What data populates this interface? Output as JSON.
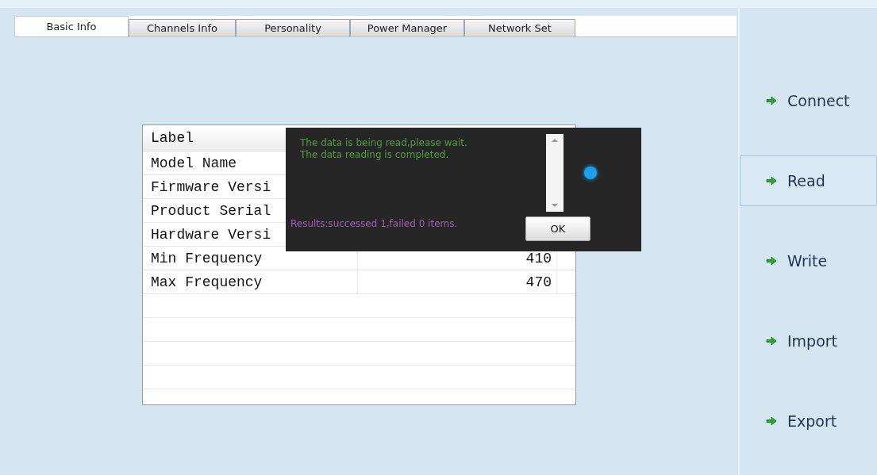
{
  "tabs": [
    {
      "label": "Basic Info",
      "selected": true
    },
    {
      "label": "Channels Info",
      "selected": false
    },
    {
      "label": "Personality",
      "selected": false
    },
    {
      "label": "Power Manager",
      "selected": false
    },
    {
      "label": "Network Set",
      "selected": false
    }
  ],
  "table": {
    "columns": [
      "Label"
    ],
    "rows": [
      {
        "label": "Model Name"
      },
      {
        "label": "Firmware Versi"
      },
      {
        "label": "Product Serial"
      },
      {
        "label": "Hardware Versi"
      },
      {
        "label": "Min Frequency",
        "value": "410"
      },
      {
        "label": "Max Frequency",
        "value": "470"
      }
    ]
  },
  "dialog": {
    "messages": [
      "The data is being read,please wait.",
      "The data reading is completed."
    ],
    "result": "Results:successed 1,failed 0 items.",
    "button": "OK"
  },
  "sidebar": {
    "buttons": [
      {
        "label": "Connect",
        "selected": false
      },
      {
        "label": "Read",
        "selected": true
      },
      {
        "label": "Write",
        "selected": false
      },
      {
        "label": "Import",
        "selected": false
      },
      {
        "label": "Export",
        "selected": false
      }
    ]
  }
}
